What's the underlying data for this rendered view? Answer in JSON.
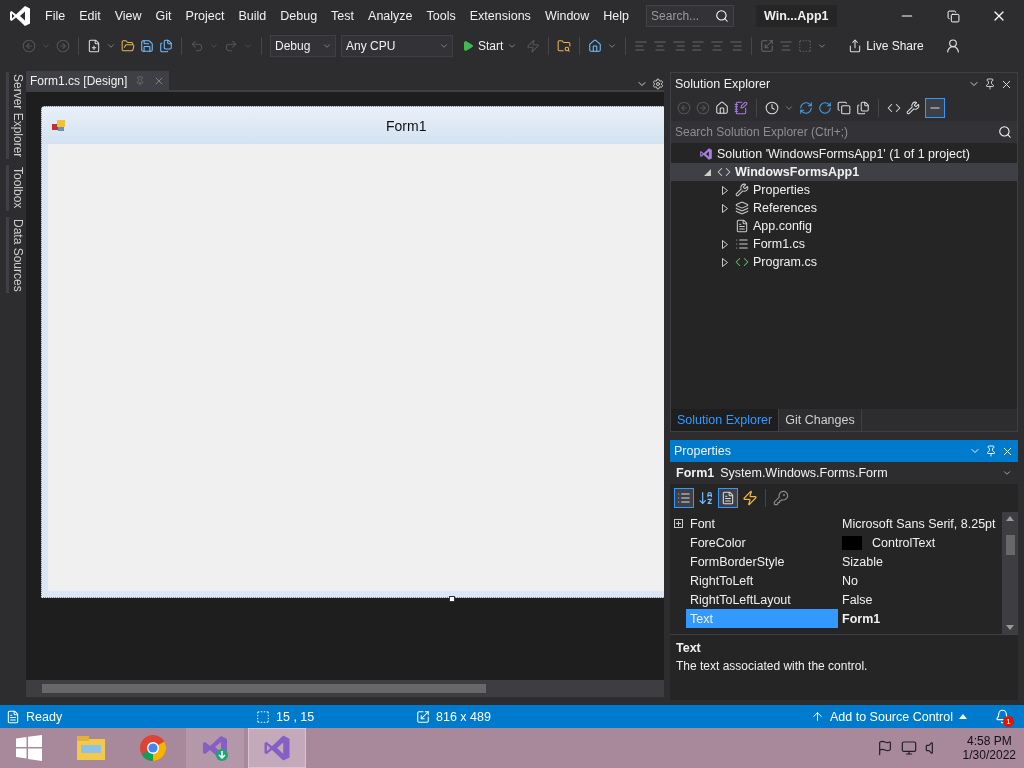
{
  "menu": [
    "File",
    "Edit",
    "View",
    "Git",
    "Project",
    "Build",
    "Debug",
    "Test",
    "Analyze",
    "Tools",
    "Extensions",
    "Window",
    "Help"
  ],
  "search": {
    "placeholder": "Search..."
  },
  "window_title": "Win...App1",
  "toolbar": {
    "configuration": "Debug",
    "platform": "Any CPU",
    "start": "Start",
    "live_share": "Live Share"
  },
  "side_tabs": [
    "Server Explorer",
    "Toolbox",
    "Data Sources"
  ],
  "document_tabs": [
    {
      "label": "Form1.cs [Design]",
      "selected": true
    }
  ],
  "form": {
    "title": "Form1"
  },
  "solution_explorer": {
    "title": "Solution Explorer",
    "search": {
      "placeholder": "Search Solution Explorer (Ctrl+;)"
    },
    "tree": [
      {
        "label": "Solution 'WindowsFormsApp1' (1 of 1 project)",
        "kind": "solution",
        "selected": false,
        "children": [
          {
            "label": "WindowsFormsApp1",
            "kind": "project",
            "selected": true,
            "expanded": true,
            "children": [
              {
                "label": "Properties",
                "kind": "wrench",
                "selected": false,
                "expanded": false
              },
              {
                "label": "References",
                "kind": "references",
                "selected": false,
                "expanded": false
              },
              {
                "label": "App.config",
                "kind": "config",
                "selected": false
              },
              {
                "label": "Form1.cs",
                "kind": "form",
                "selected": false,
                "expanded": false
              },
              {
                "label": "Program.cs",
                "kind": "csharp",
                "selected": false,
                "expanded": false
              }
            ]
          }
        ]
      }
    ]
  },
  "panel_tabs": [
    {
      "label": "Solution Explorer",
      "selected": true
    },
    {
      "label": "Git Changes",
      "selected": false
    }
  ],
  "properties": {
    "title": "Properties",
    "object_name": "Form1",
    "object_type": "System.Windows.Forms.Form",
    "rows": [
      {
        "name": "Font",
        "value": "Microsoft Sans Serif, 8.25pt",
        "expandable": true,
        "modified": false,
        "selected": false
      },
      {
        "name": "ForeColor",
        "value": "ControlText",
        "color": "#000000",
        "expandable": false,
        "modified": false,
        "selected": false
      },
      {
        "name": "FormBorderStyle",
        "value": "Sizable",
        "expandable": false,
        "modified": false,
        "selected": false
      },
      {
        "name": "RightToLeft",
        "value": "No",
        "expandable": false,
        "modified": false,
        "selected": false
      },
      {
        "name": "RightToLeftLayout",
        "value": "False",
        "expandable": false,
        "modified": false,
        "selected": false
      },
      {
        "name": "Text",
        "value": "Form1",
        "expandable": false,
        "modified": true,
        "selected": true
      }
    ],
    "description": {
      "title": "Text",
      "text": "The text associated with the control."
    }
  },
  "status_bar": {
    "text": "Ready",
    "position": "15 , 15",
    "size": "816 x 489",
    "source_control": "Add to Source Control",
    "notifications": "1"
  },
  "taskbar": {
    "apps": [
      {
        "kind": "files",
        "selected": false
      },
      {
        "kind": "browser",
        "selected": false
      },
      {
        "kind": "installer",
        "selected": false
      },
      {
        "kind": "ide",
        "selected": true
      }
    ],
    "time": "4:58 PM",
    "date": "1/30/2022"
  }
}
